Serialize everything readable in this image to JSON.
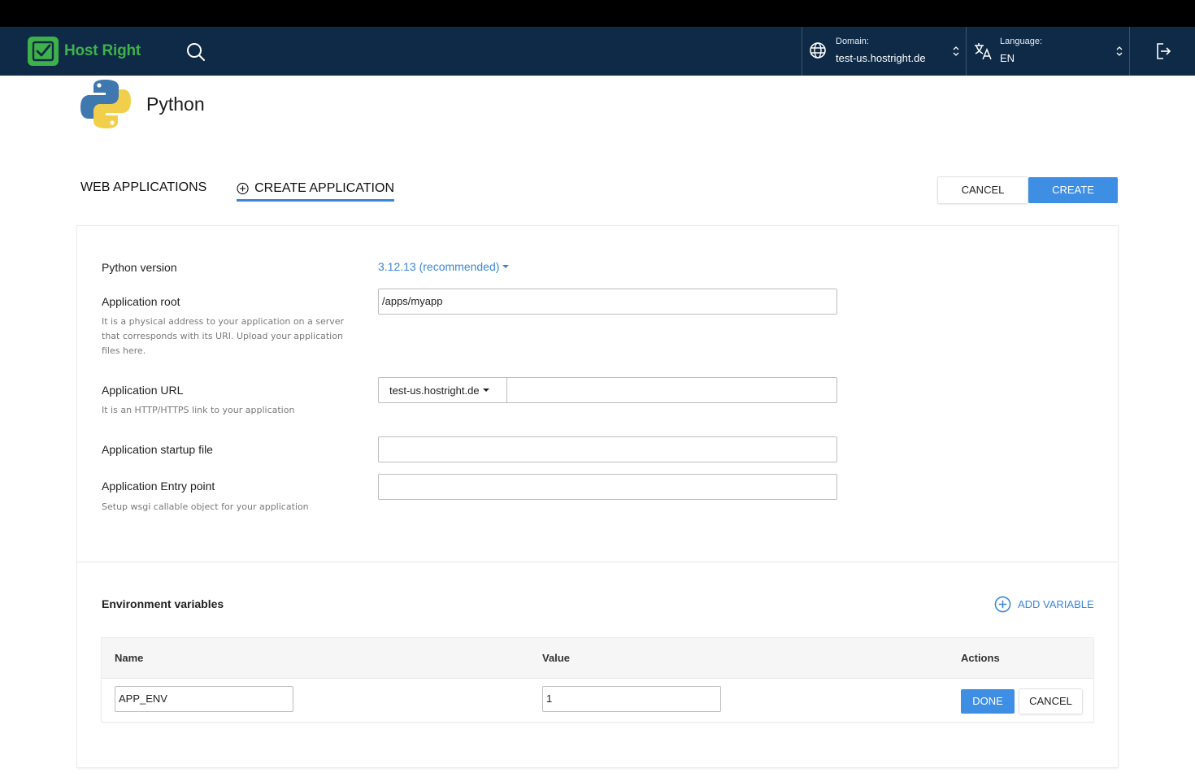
{
  "brand": {
    "name": "Host Right",
    "accent": "#3fb14a",
    "nav_bg": "#0e2a47"
  },
  "nav": {
    "search_icon": "search-icon",
    "domain_label": "Domain:",
    "domain_value": "test-us.hostright.de",
    "language_label": "Language:",
    "language_value": "EN",
    "logout_icon": "logout-icon"
  },
  "app": {
    "title": "Python",
    "icon": "python-logo"
  },
  "tabs": [
    {
      "label": "WEB APPLICATIONS",
      "active": false
    },
    {
      "label": "CREATE APPLICATION",
      "active": true,
      "icon": "plus-circle-icon"
    }
  ],
  "actions": {
    "cancel_label": "CANCEL",
    "create_label": "CREATE",
    "primary_color": "#3e8ee3"
  },
  "form": {
    "python_version": {
      "label": "Python version",
      "value": "3.12.13 (recommended)"
    },
    "app_root": {
      "label": "Application root",
      "help": "It is a physical address to your application on a server that corresponds with its URI. Upload your application files here.",
      "value": "/apps/myapp"
    },
    "app_url": {
      "label": "Application URL",
      "help": "It is an HTTP/HTTPS link to your application",
      "domain": "test-us.hostright.de",
      "path": ""
    },
    "startup_file": {
      "label": "Application startup file",
      "value": ""
    },
    "entry_point": {
      "label": "Application Entry point",
      "help": "Setup wsgi callable object for your application",
      "value": ""
    }
  },
  "env": {
    "title": "Environment variables",
    "add_label": "ADD VARIABLE",
    "columns": [
      "Name",
      "Value",
      "Actions"
    ],
    "rows": [
      {
        "name": "APP_ENV",
        "value": "1",
        "done_label": "DONE",
        "cancel_label": "CANCEL"
      }
    ]
  }
}
